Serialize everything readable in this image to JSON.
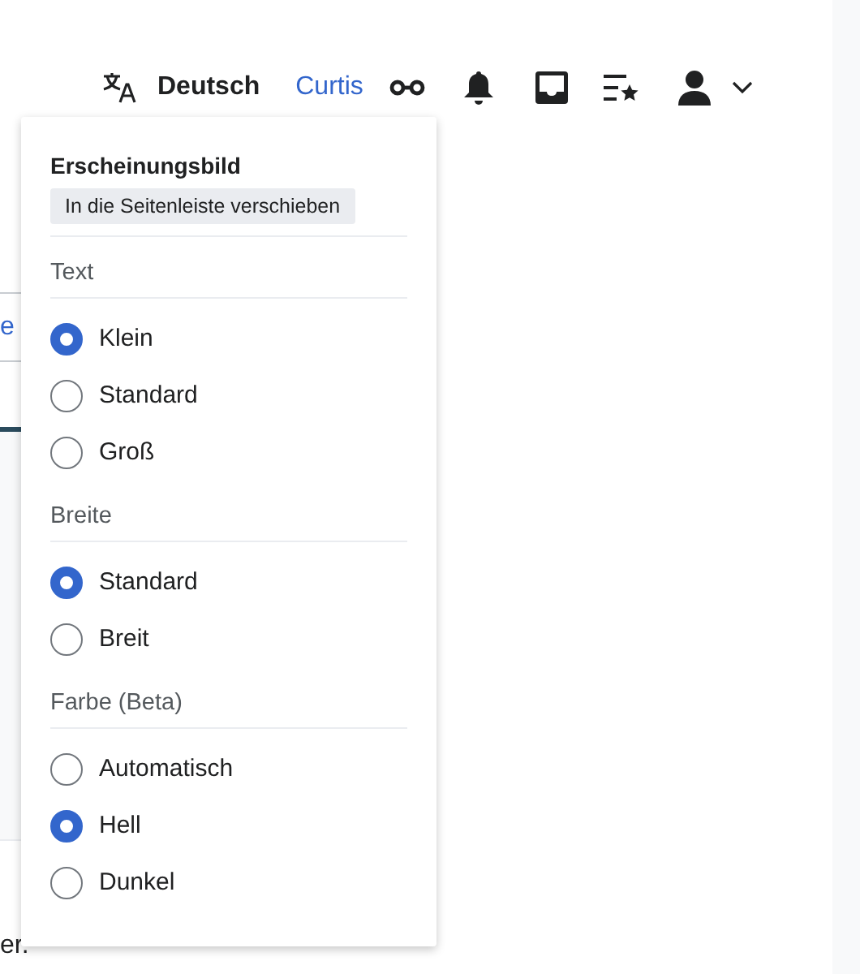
{
  "header": {
    "language": "Deutsch",
    "user": "Curtis"
  },
  "background": {
    "link_fragment": "e",
    "footer_fragment": "er."
  },
  "appearance": {
    "title": "Erscheinungsbild",
    "move_button": "In die Seitenleiste verschieben",
    "groups": [
      {
        "label": "Text",
        "options": [
          {
            "label": "Klein",
            "selected": true
          },
          {
            "label": "Standard",
            "selected": false
          },
          {
            "label": "Groß",
            "selected": false
          }
        ]
      },
      {
        "label": "Breite",
        "options": [
          {
            "label": "Standard",
            "selected": true
          },
          {
            "label": "Breit",
            "selected": false
          }
        ]
      },
      {
        "label": "Farbe (Beta)",
        "options": [
          {
            "label": "Automatisch",
            "selected": false
          },
          {
            "label": "Hell",
            "selected": true
          },
          {
            "label": "Dunkel",
            "selected": false
          }
        ]
      }
    ]
  }
}
